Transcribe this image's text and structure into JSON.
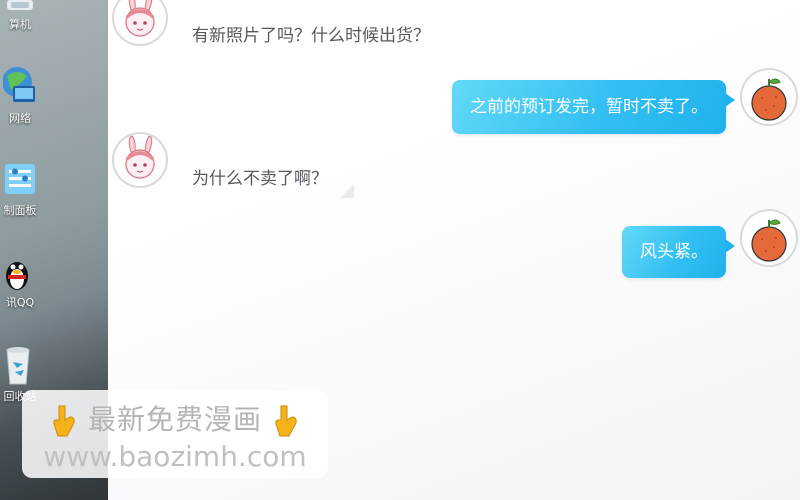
{
  "desktop": {
    "icons": [
      {
        "label": "算机",
        "icon": "computer-icon"
      },
      {
        "label": "网络",
        "icon": "network-icon"
      },
      {
        "label": "制面板",
        "icon": "control-panel-icon"
      },
      {
        "label": "讯QQ",
        "icon": "qq-penguin-icon"
      },
      {
        "label": "回收站",
        "icon": "recycle-bin-icon"
      }
    ]
  },
  "chat": {
    "messages": [
      {
        "side": "left",
        "sender_avatar": "bunny-girl-avatar",
        "text": "有新照片了吗？什么时候出货？"
      },
      {
        "side": "right",
        "sender_avatar": "orange-avatar",
        "text": "之前的预订发完，暂时不卖了。"
      },
      {
        "side": "left",
        "sender_avatar": "bunny-girl-avatar",
        "text": "为什么不卖了啊？"
      },
      {
        "side": "right",
        "sender_avatar": "orange-avatar",
        "text": "风头紧。"
      }
    ],
    "colors": {
      "bubble_right": "#33bff2",
      "text_left": "#555a60",
      "orange": "#e46a3c",
      "bunny_pink": "#e88a96"
    }
  },
  "watermark": {
    "line1": "最新免费漫画",
    "line2": "www.baozimh.com",
    "icon": "pointing-down-hand-icon"
  }
}
